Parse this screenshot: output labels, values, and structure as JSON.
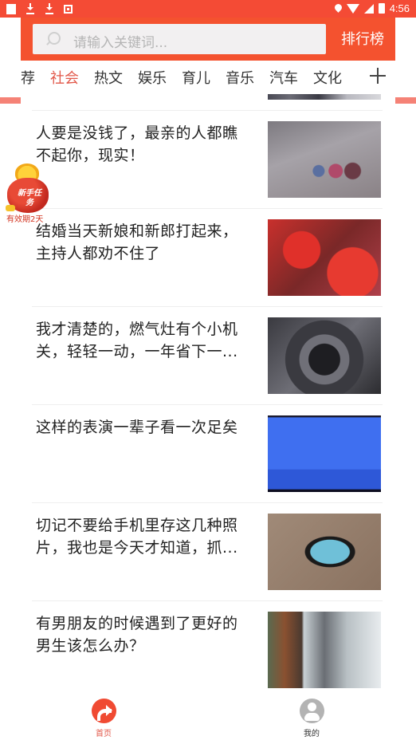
{
  "status_bar": {
    "left_icons": [
      "notification-square-icon",
      "download-icon",
      "download-icon",
      "image-notification-icon"
    ],
    "right_icons": [
      "location-icon",
      "wifi-icon",
      "signal-icon",
      "battery-icon"
    ],
    "time": "4:56"
  },
  "header": {
    "search": {
      "placeholder": "请输入关键词..."
    },
    "rank_label": "排行榜",
    "tabs": [
      {
        "label": "荐",
        "active": false
      },
      {
        "label": "社会",
        "active": true
      },
      {
        "label": "热文",
        "active": false
      },
      {
        "label": "娱乐",
        "active": false
      },
      {
        "label": "育儿",
        "active": false
      },
      {
        "label": "音乐",
        "active": false
      },
      {
        "label": "汽车",
        "active": false
      },
      {
        "label": "文化",
        "active": false
      }
    ],
    "add_tab_icon": "plus-icon"
  },
  "feed": {
    "items": [
      {
        "title": "人要是没钱了，最亲的人都瞧不起你，现实！"
      },
      {
        "title": "结婚当天新娘和新郎打起来，主持人都劝不住了"
      },
      {
        "title": "我才清楚的，燃气灶有个小机关，轻轻一动，一年省下一..."
      },
      {
        "title": "这样的表演一辈子看一次足矣"
      },
      {
        "title": "切记不要给手机里存这几种照片，我也是今天才知道，抓..."
      },
      {
        "title": "有男朋友的时候遇到了更好的男生该怎么办？"
      }
    ]
  },
  "bonus_badge": {
    "label": "新手任务",
    "caption": "有效期2天"
  },
  "bottom_nav": {
    "items": [
      {
        "label": "首页",
        "icon": "share-arrow-icon",
        "active": true
      },
      {
        "label": "我的",
        "icon": "user-icon",
        "active": false
      }
    ]
  },
  "colors": {
    "status_bar": "#f44b35",
    "header_red": "#f4522f",
    "active_tab": "#e2584a",
    "side_bar": "#f58276"
  }
}
